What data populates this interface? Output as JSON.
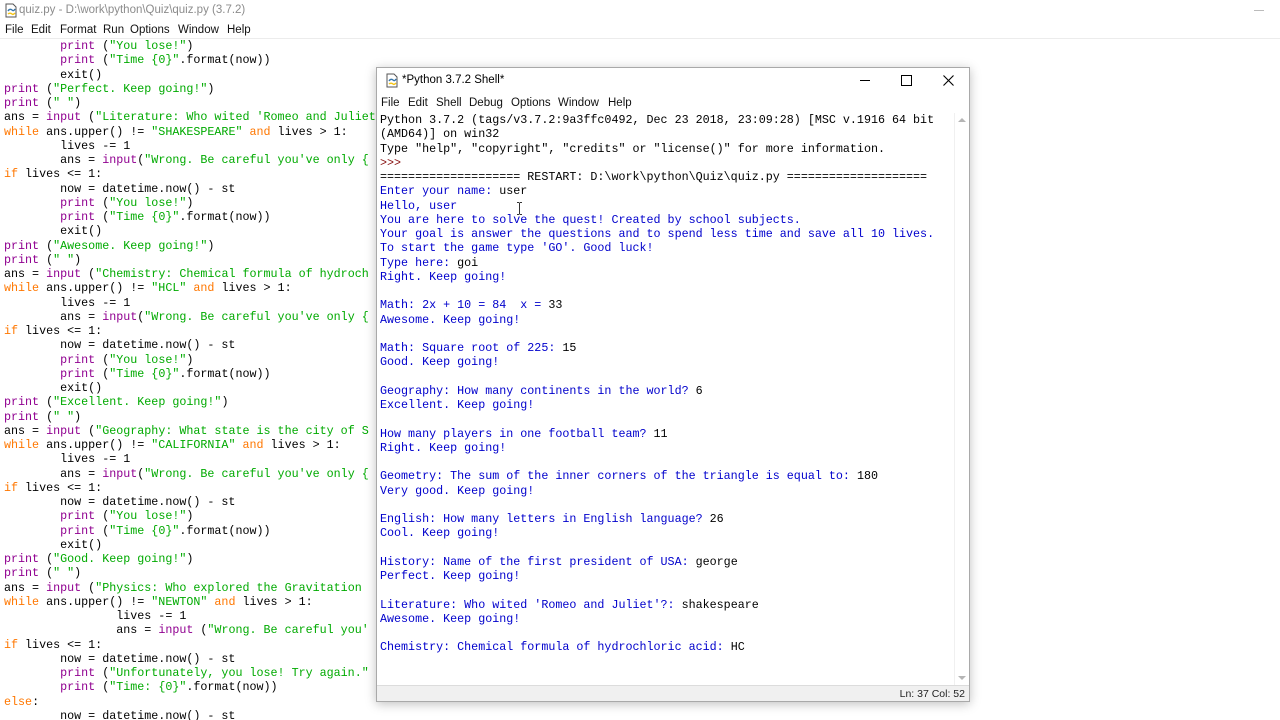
{
  "editor": {
    "title": "quiz.py - D:\\work\\python\\Quiz\\quiz.py (3.7.2)",
    "menu": [
      "File",
      "Edit",
      "Format",
      "Run",
      "Options",
      "Window",
      "Help"
    ],
    "code_lines": [
      [
        [
          "pad",
          "        "
        ],
        [
          "bi",
          "print"
        ],
        [
          "t",
          " ("
        ],
        [
          "str",
          "\"You lose!\""
        ],
        [
          "t",
          ")"
        ]
      ],
      [
        [
          "pad",
          "        "
        ],
        [
          "bi",
          "print"
        ],
        [
          "t",
          " ("
        ],
        [
          "str",
          "\"Time {0}\""
        ],
        [
          "t",
          ".format(now))"
        ]
      ],
      [
        [
          "pad",
          "        "
        ],
        [
          "t",
          "exit()"
        ]
      ],
      [
        [
          "bi",
          "print"
        ],
        [
          "t",
          " ("
        ],
        [
          "str",
          "\"Perfect. Keep going!\""
        ],
        [
          "t",
          ")"
        ]
      ],
      [
        [
          "bi",
          "print"
        ],
        [
          "t",
          " ("
        ],
        [
          "str",
          "\" \""
        ],
        [
          "t",
          ")"
        ]
      ],
      [
        [
          "t",
          "ans = "
        ],
        [
          "bi",
          "input"
        ],
        [
          "t",
          " ("
        ],
        [
          "str",
          "\"Literature: Who wited 'Romeo and Juliet"
        ]
      ],
      [
        [
          "kw",
          "while"
        ],
        [
          "t",
          " ans.upper() != "
        ],
        [
          "str",
          "\"SHAKESPEARE\""
        ],
        [
          "t",
          " "
        ],
        [
          "kw",
          "and"
        ],
        [
          "t",
          " lives > 1:"
        ]
      ],
      [
        [
          "pad",
          "        "
        ],
        [
          "t",
          "lives -= 1"
        ]
      ],
      [
        [
          "pad",
          "        "
        ],
        [
          "t",
          "ans = "
        ],
        [
          "bi",
          "input"
        ],
        [
          "t",
          "("
        ],
        [
          "str",
          "\"Wrong. Be careful you've only {"
        ]
      ],
      [
        [
          "kw",
          "if"
        ],
        [
          "t",
          " lives <= 1:"
        ]
      ],
      [
        [
          "pad",
          "        "
        ],
        [
          "t",
          "now = datetime.now() - st"
        ]
      ],
      [
        [
          "pad",
          "        "
        ],
        [
          "bi",
          "print"
        ],
        [
          "t",
          " ("
        ],
        [
          "str",
          "\"You lose!\""
        ],
        [
          "t",
          ")"
        ]
      ],
      [
        [
          "pad",
          "        "
        ],
        [
          "bi",
          "print"
        ],
        [
          "t",
          " ("
        ],
        [
          "str",
          "\"Time {0}\""
        ],
        [
          "t",
          ".format(now))"
        ]
      ],
      [
        [
          "pad",
          "        "
        ],
        [
          "t",
          "exit()"
        ]
      ],
      [
        [
          "bi",
          "print"
        ],
        [
          "t",
          " ("
        ],
        [
          "str",
          "\"Awesome. Keep going!\""
        ],
        [
          "t",
          ")"
        ]
      ],
      [
        [
          "bi",
          "print"
        ],
        [
          "t",
          " ("
        ],
        [
          "str",
          "\" \""
        ],
        [
          "t",
          ")"
        ]
      ],
      [
        [
          "t",
          "ans = "
        ],
        [
          "bi",
          "input"
        ],
        [
          "t",
          " ("
        ],
        [
          "str",
          "\"Chemistry: Chemical formula of hydroch"
        ]
      ],
      [
        [
          "kw",
          "while"
        ],
        [
          "t",
          " ans.upper() != "
        ],
        [
          "str",
          "\"HCL\""
        ],
        [
          "t",
          " "
        ],
        [
          "kw",
          "and"
        ],
        [
          "t",
          " lives > 1:"
        ]
      ],
      [
        [
          "pad",
          "        "
        ],
        [
          "t",
          "lives -= 1"
        ]
      ],
      [
        [
          "pad",
          "        "
        ],
        [
          "t",
          "ans = "
        ],
        [
          "bi",
          "input"
        ],
        [
          "t",
          "("
        ],
        [
          "str",
          "\"Wrong. Be careful you've only {"
        ]
      ],
      [
        [
          "kw",
          "if"
        ],
        [
          "t",
          " lives <= 1:"
        ]
      ],
      [
        [
          "pad",
          "        "
        ],
        [
          "t",
          "now = datetime.now() - st"
        ]
      ],
      [
        [
          "pad",
          "        "
        ],
        [
          "bi",
          "print"
        ],
        [
          "t",
          " ("
        ],
        [
          "str",
          "\"You lose!\""
        ],
        [
          "t",
          ")"
        ]
      ],
      [
        [
          "pad",
          "        "
        ],
        [
          "bi",
          "print"
        ],
        [
          "t",
          " ("
        ],
        [
          "str",
          "\"Time {0}\""
        ],
        [
          "t",
          ".format(now))"
        ]
      ],
      [
        [
          "pad",
          "        "
        ],
        [
          "t",
          "exit()"
        ]
      ],
      [
        [
          "bi",
          "print"
        ],
        [
          "t",
          " ("
        ],
        [
          "str",
          "\"Excellent. Keep going!\""
        ],
        [
          "t",
          ")"
        ]
      ],
      [
        [
          "bi",
          "print"
        ],
        [
          "t",
          " ("
        ],
        [
          "str",
          "\" \""
        ],
        [
          "t",
          ")"
        ]
      ],
      [
        [
          "t",
          "ans = "
        ],
        [
          "bi",
          "input"
        ],
        [
          "t",
          " ("
        ],
        [
          "str",
          "\"Geography: What state is the city of S"
        ]
      ],
      [
        [
          "kw",
          "while"
        ],
        [
          "t",
          " ans.upper() != "
        ],
        [
          "str",
          "\"CALIFORNIA\""
        ],
        [
          "t",
          " "
        ],
        [
          "kw",
          "and"
        ],
        [
          "t",
          " lives > 1:"
        ]
      ],
      [
        [
          "pad",
          "        "
        ],
        [
          "t",
          "lives -= 1"
        ]
      ],
      [
        [
          "pad",
          "        "
        ],
        [
          "t",
          "ans = "
        ],
        [
          "bi",
          "input"
        ],
        [
          "t",
          "("
        ],
        [
          "str",
          "\"Wrong. Be careful you've only {"
        ]
      ],
      [
        [
          "kw",
          "if"
        ],
        [
          "t",
          " lives <= 1:"
        ]
      ],
      [
        [
          "pad",
          "        "
        ],
        [
          "t",
          "now = datetime.now() - st"
        ]
      ],
      [
        [
          "pad",
          "        "
        ],
        [
          "bi",
          "print"
        ],
        [
          "t",
          " ("
        ],
        [
          "str",
          "\"You lose!\""
        ],
        [
          "t",
          ")"
        ]
      ],
      [
        [
          "pad",
          "        "
        ],
        [
          "bi",
          "print"
        ],
        [
          "t",
          " ("
        ],
        [
          "str",
          "\"Time {0}\""
        ],
        [
          "t",
          ".format(now))"
        ]
      ],
      [
        [
          "pad",
          "        "
        ],
        [
          "t",
          "exit()"
        ]
      ],
      [
        [
          "bi",
          "print"
        ],
        [
          "t",
          " ("
        ],
        [
          "str",
          "\"Good. Keep going!\""
        ],
        [
          "t",
          ")"
        ]
      ],
      [
        [
          "bi",
          "print"
        ],
        [
          "t",
          " ("
        ],
        [
          "str",
          "\" \""
        ],
        [
          "t",
          ")"
        ]
      ],
      [
        [
          "t",
          "ans = "
        ],
        [
          "bi",
          "input"
        ],
        [
          "t",
          " ("
        ],
        [
          "str",
          "\"Physics: Who explored the Gravitation "
        ]
      ],
      [
        [
          "kw",
          "while"
        ],
        [
          "t",
          " ans.upper() != "
        ],
        [
          "str",
          "\"NEWTON\""
        ],
        [
          "t",
          " "
        ],
        [
          "kw",
          "and"
        ],
        [
          "t",
          " lives > 1:"
        ]
      ],
      [
        [
          "pad",
          "                "
        ],
        [
          "t",
          "lives -= 1"
        ]
      ],
      [
        [
          "pad",
          "                "
        ],
        [
          "t",
          "ans = "
        ],
        [
          "bi",
          "input"
        ],
        [
          "t",
          " ("
        ],
        [
          "str",
          "\"Wrong. Be careful you'"
        ]
      ],
      [
        [
          "kw",
          "if"
        ],
        [
          "t",
          " lives <= 1:"
        ]
      ],
      [
        [
          "pad",
          "        "
        ],
        [
          "t",
          "now = datetime.now() - st"
        ]
      ],
      [
        [
          "pad",
          "        "
        ],
        [
          "bi",
          "print"
        ],
        [
          "t",
          " ("
        ],
        [
          "str",
          "\"Unfortunately, you lose! Try again.\""
        ]
      ],
      [
        [
          "pad",
          "        "
        ],
        [
          "bi",
          "print"
        ],
        [
          "t",
          " ("
        ],
        [
          "str",
          "\"Time: {0}\""
        ],
        [
          "t",
          ".format(now))"
        ]
      ],
      [
        [
          "kw",
          "else"
        ],
        [
          "t",
          ":"
        ]
      ],
      [
        [
          "pad",
          "        "
        ],
        [
          "t",
          "now = datetime.now() - st"
        ]
      ]
    ]
  },
  "shell": {
    "title": "*Python 3.7.2 Shell*",
    "menu": [
      "File",
      "Edit",
      "Shell",
      "Debug",
      "Options",
      "Window",
      "Help"
    ],
    "lines": [
      [
        [
          "out",
          "Python 3.7.2 (tags/v3.7.2:9a3ffc0492, Dec 23 2018, 23:09:28) [MSC v.1916 64 bit"
        ]
      ],
      [
        [
          "out",
          "(AMD64)] on win32"
        ]
      ],
      [
        [
          "out",
          "Type \"help\", \"copyright\", \"credits\" or \"license()\" for more information."
        ]
      ],
      [
        [
          "prm",
          ">>> "
        ]
      ],
      [
        [
          "out",
          "==================== RESTART: D:\\work\\python\\Quiz\\quiz.py ===================="
        ]
      ],
      [
        [
          "usr",
          "Enter your name: "
        ],
        [
          "out",
          "user"
        ]
      ],
      [
        [
          "usr",
          "Hello, user"
        ]
      ],
      [
        [
          "usr",
          "You are here to solve the quest! Created by school subjects."
        ]
      ],
      [
        [
          "usr",
          "Your goal is answer the questions and to spend less time and save all 10 lives."
        ]
      ],
      [
        [
          "usr",
          "To start the game type 'GO'. Good luck!"
        ]
      ],
      [
        [
          "usr",
          "Type here: "
        ],
        [
          "out",
          "goi"
        ]
      ],
      [
        [
          "usr",
          "Right. Keep going!"
        ]
      ],
      [
        [
          "out",
          " "
        ]
      ],
      [
        [
          "usr",
          "Math: 2x + 10 = 84  x = "
        ],
        [
          "out",
          "33"
        ]
      ],
      [
        [
          "usr",
          "Awesome. Keep going!"
        ]
      ],
      [
        [
          "out",
          " "
        ]
      ],
      [
        [
          "usr",
          "Math: Square root of 225: "
        ],
        [
          "out",
          "15"
        ]
      ],
      [
        [
          "usr",
          "Good. Keep going!"
        ]
      ],
      [
        [
          "out",
          " "
        ]
      ],
      [
        [
          "usr",
          "Geography: How many continents in the world? "
        ],
        [
          "out",
          "6"
        ]
      ],
      [
        [
          "usr",
          "Excellent. Keep going!"
        ]
      ],
      [
        [
          "out",
          " "
        ]
      ],
      [
        [
          "usr",
          "How many players in one football team? "
        ],
        [
          "out",
          "11"
        ]
      ],
      [
        [
          "usr",
          "Right. Keep going!"
        ]
      ],
      [
        [
          "out",
          " "
        ]
      ],
      [
        [
          "usr",
          "Geometry: The sum of the inner corners of the triangle is equal to: "
        ],
        [
          "out",
          "180"
        ]
      ],
      [
        [
          "usr",
          "Very good. Keep going!"
        ]
      ],
      [
        [
          "out",
          " "
        ]
      ],
      [
        [
          "usr",
          "English: How many letters in English language? "
        ],
        [
          "out",
          "26"
        ]
      ],
      [
        [
          "usr",
          "Cool. Keep going!"
        ]
      ],
      [
        [
          "out",
          " "
        ]
      ],
      [
        [
          "usr",
          "History: Name of the first president of USA: "
        ],
        [
          "out",
          "george"
        ]
      ],
      [
        [
          "usr",
          "Perfect. Keep going!"
        ]
      ],
      [
        [
          "out",
          " "
        ]
      ],
      [
        [
          "usr",
          "Literature: Who wited 'Romeo and Juliet'?: "
        ],
        [
          "out",
          "shakespeare"
        ]
      ],
      [
        [
          "usr",
          "Awesome. Keep going!"
        ]
      ],
      [
        [
          "out",
          " "
        ]
      ],
      [
        [
          "usr",
          "Chemistry: Chemical formula of hydrochloric acid: "
        ],
        [
          "out",
          "HC"
        ]
      ]
    ],
    "status": "Ln: 37  Col: 52"
  }
}
